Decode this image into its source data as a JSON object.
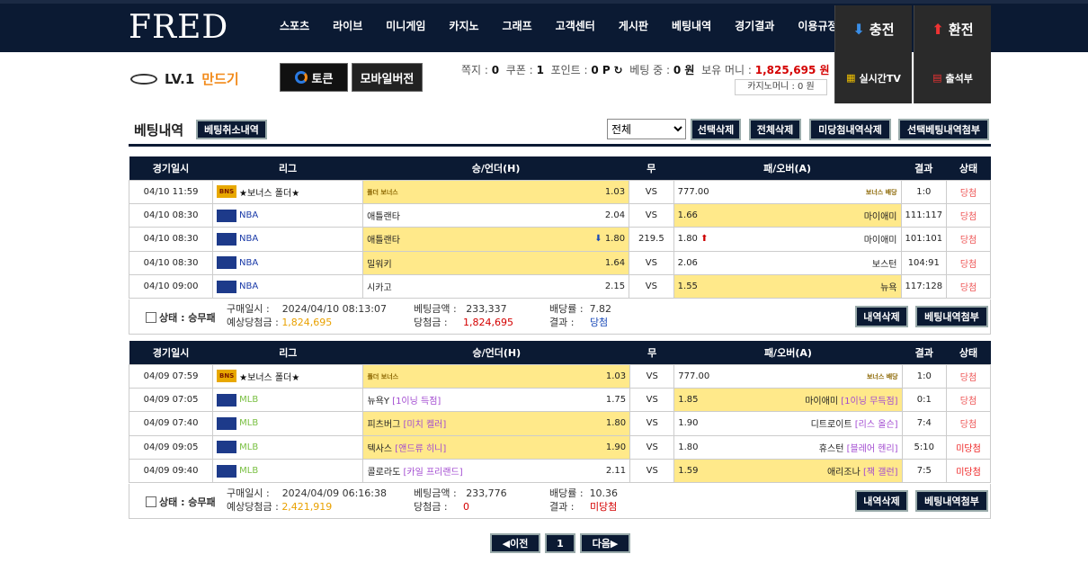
{
  "logo": "FRED",
  "nav": [
    "스포츠",
    "라이브",
    "미니게임",
    "카지노",
    "그래프",
    "고객센터",
    "게시판",
    "베팅내역",
    "경기결과",
    "이용규정"
  ],
  "charge": "충전",
  "exchange": "환전",
  "user": {
    "level": "LV.1",
    "nick": "만드기"
  },
  "toss": "토큰",
  "mobile": "모바일버전",
  "info": {
    "note_label": "쪽지 :",
    "note": "0",
    "coupon_label": "쿠폰 :",
    "coupon": "1",
    "point_label": "포인트 :",
    "point": "0 P",
    "betting_label": "베팅 중 :",
    "betting": "0 원",
    "money_label": "보유 머니 :",
    "money": "1,825,695 원"
  },
  "casino_money": "카지노머니 : 0 원",
  "live_tv": "실시간TV",
  "attendance": "출석부",
  "page_title": "베팅내역",
  "cancel_history": "베팅취소내역",
  "filter": {
    "selected": "전체"
  },
  "actions": [
    "선택삭제",
    "전체삭제",
    "미당첨내역삭제",
    "선택베팅내역첨부"
  ],
  "headers": [
    "경기일시",
    "리그",
    "승/언더(H)",
    "무",
    "패/오버(A)",
    "결과",
    "상태"
  ],
  "bets": [
    {
      "rows": [
        {
          "date": "04/10 11:59",
          "league": "★보너스 폴더★",
          "lg": "bonus",
          "home": "",
          "home_tag": "폴더 보너스",
          "home_odds": "1.03",
          "home_sel": true,
          "draw": "VS",
          "away_odds": "777.00",
          "away": "",
          "away_tag": "보너스 배당",
          "away_sel": false,
          "result": "1:0",
          "status": "당첨"
        },
        {
          "date": "04/10 08:30",
          "league": "NBA",
          "lg": "nba",
          "home": "애틀랜타",
          "home_odds": "2.04",
          "home_sel": false,
          "draw": "VS",
          "away_odds": "1.66",
          "away": "마이애미",
          "away_sel": true,
          "result": "111:117",
          "status": "당첨"
        },
        {
          "date": "04/10 08:30",
          "league": "NBA",
          "lg": "nba",
          "home": "애틀랜타",
          "home_odds": "1.80",
          "home_arrow": "down",
          "home_sel": true,
          "draw": "219.5",
          "away_odds": "1.80",
          "away_arrow": "up",
          "away": "마이애미",
          "away_sel": false,
          "result": "101:101",
          "status": "당첨"
        },
        {
          "date": "04/10 08:30",
          "league": "NBA",
          "lg": "nba",
          "home": "밀워키",
          "home_odds": "1.64",
          "home_sel": true,
          "draw": "VS",
          "away_odds": "2.06",
          "away": "보스턴",
          "away_sel": false,
          "result": "104:91",
          "status": "당첨"
        },
        {
          "date": "04/10 09:00",
          "league": "NBA",
          "lg": "nba",
          "home": "시카고",
          "home_odds": "2.15",
          "home_sel": false,
          "draw": "VS",
          "away_odds": "1.55",
          "away": "뉴욕",
          "away_sel": true,
          "result": "117:128",
          "status": "당첨"
        }
      ],
      "summary": {
        "status": "상태 : 승무패",
        "buy_label": "구매일시 :",
        "buy": "2024/04/10 08:13:07",
        "expect_label": "예상당첨금 :",
        "expect": "1,824,695",
        "amount_label": "베팅금액 :",
        "amount": "233,337",
        "win_label": "당첨금 :",
        "win": "1,824,695",
        "rate_label": "배당률 :",
        "rate": "7.82",
        "result_label": "결과 :",
        "result": "당첨"
      }
    },
    {
      "rows": [
        {
          "date": "04/09 07:59",
          "league": "★보너스 폴더★",
          "lg": "bonus",
          "home": "",
          "home_tag": "폴더 보너스",
          "home_odds": "1.03",
          "home_sel": true,
          "draw": "VS",
          "away_odds": "777.00",
          "away": "",
          "away_tag": "보너스 배당",
          "away_sel": false,
          "result": "1:0",
          "status": "당첨"
        },
        {
          "date": "04/09 07:05",
          "league": "MLB",
          "lg": "mlb",
          "home": "뉴욕Y",
          "home_p": "[1이닝 득점]",
          "home_odds": "1.75",
          "home_sel": false,
          "draw": "VS",
          "away_odds": "1.85",
          "away": "마이애미",
          "away_p": "[1이닝 무득점]",
          "away_sel": true,
          "result": "0:1",
          "status": "당첨"
        },
        {
          "date": "04/09 07:40",
          "league": "MLB",
          "lg": "mlb",
          "home": "피츠버그",
          "home_p": "[미치 켈러]",
          "home_odds": "1.80",
          "home_sel": true,
          "draw": "VS",
          "away_odds": "1.90",
          "away": "디트로이트",
          "away_p": "[리스 올슨]",
          "away_sel": false,
          "result": "7:4",
          "status": "당첨"
        },
        {
          "date": "04/09 09:05",
          "league": "MLB",
          "lg": "mlb",
          "home": "텍사스",
          "home_p": "[앤드류 히니]",
          "home_odds": "1.90",
          "home_sel": true,
          "draw": "VS",
          "away_odds": "1.80",
          "away": "휴스턴",
          "away_p": "[블레어 헨리]",
          "away_sel": false,
          "result": "5:10",
          "status": "미당첨"
        },
        {
          "date": "04/09 09:40",
          "league": "MLB",
          "lg": "mlb",
          "home": "콜로라도",
          "home_p": "[카일 프리랜드]",
          "home_odds": "2.11",
          "home_sel": false,
          "draw": "VS",
          "away_odds": "1.59",
          "away": "애리조나",
          "away_p": "[잭 갤런]",
          "away_sel": true,
          "result": "7:5",
          "status": "미당첨"
        }
      ],
      "summary": {
        "status": "상태 : 승무패",
        "buy_label": "구매일시 :",
        "buy": "2024/04/09 06:16:38",
        "expect_label": "예상당첨금 :",
        "expect": "2,421,919",
        "amount_label": "베팅금액 :",
        "amount": "233,776",
        "win_label": "당첨금 :",
        "win": "0",
        "rate_label": "배당률 :",
        "rate": "10.36",
        "result_label": "결과 :",
        "result": "미당첨"
      }
    }
  ],
  "row_buttons": {
    "delete": "내역삭제",
    "attach": "베팅내역첨부"
  },
  "pager": {
    "prev": "◀이전",
    "page": "1",
    "next": "다음▶"
  }
}
